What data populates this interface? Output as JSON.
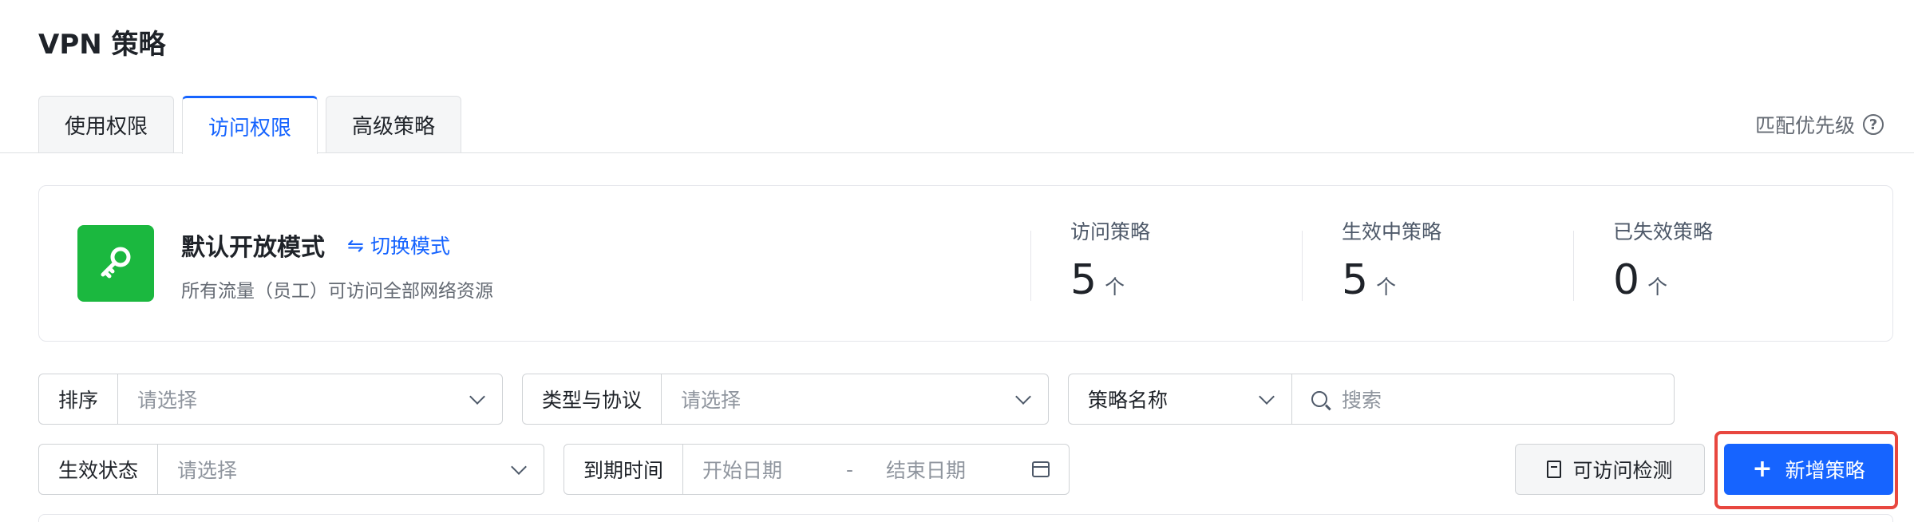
{
  "page": {
    "title": "VPN 策略"
  },
  "tabs": [
    {
      "label": "使用权限",
      "active": false
    },
    {
      "label": "访问权限",
      "active": true
    },
    {
      "label": "高级策略",
      "active": false
    }
  ],
  "priority": {
    "label": "匹配优先级",
    "icon": "help-circle-icon"
  },
  "mode": {
    "title": "默认开放模式",
    "switch_label": "切换模式",
    "description": "所有流量（员工）可访问全部网络资源",
    "icon": "key-icon",
    "icon_color": "#1bb83f"
  },
  "stats": [
    {
      "label": "访问策略",
      "value": "5",
      "unit": "个"
    },
    {
      "label": "生效中策略",
      "value": "5",
      "unit": "个"
    },
    {
      "label": "已失效策略",
      "value": "0",
      "unit": "个"
    }
  ],
  "filters": {
    "sort": {
      "label": "排序",
      "placeholder": "请选择"
    },
    "type": {
      "label": "类型与协议",
      "placeholder": "请选择"
    },
    "name": {
      "label": "策略名称",
      "placeholder": "搜索"
    },
    "status": {
      "label": "生效状态",
      "placeholder": "请选择"
    },
    "expire": {
      "label": "到期时间",
      "start_placeholder": "开始日期",
      "separator": "-",
      "end_placeholder": "结束日期"
    }
  },
  "actions": {
    "check_label": "可访问检测",
    "add_label": "新增策略",
    "accent": "#1664ff",
    "highlight": "#e8473f"
  }
}
